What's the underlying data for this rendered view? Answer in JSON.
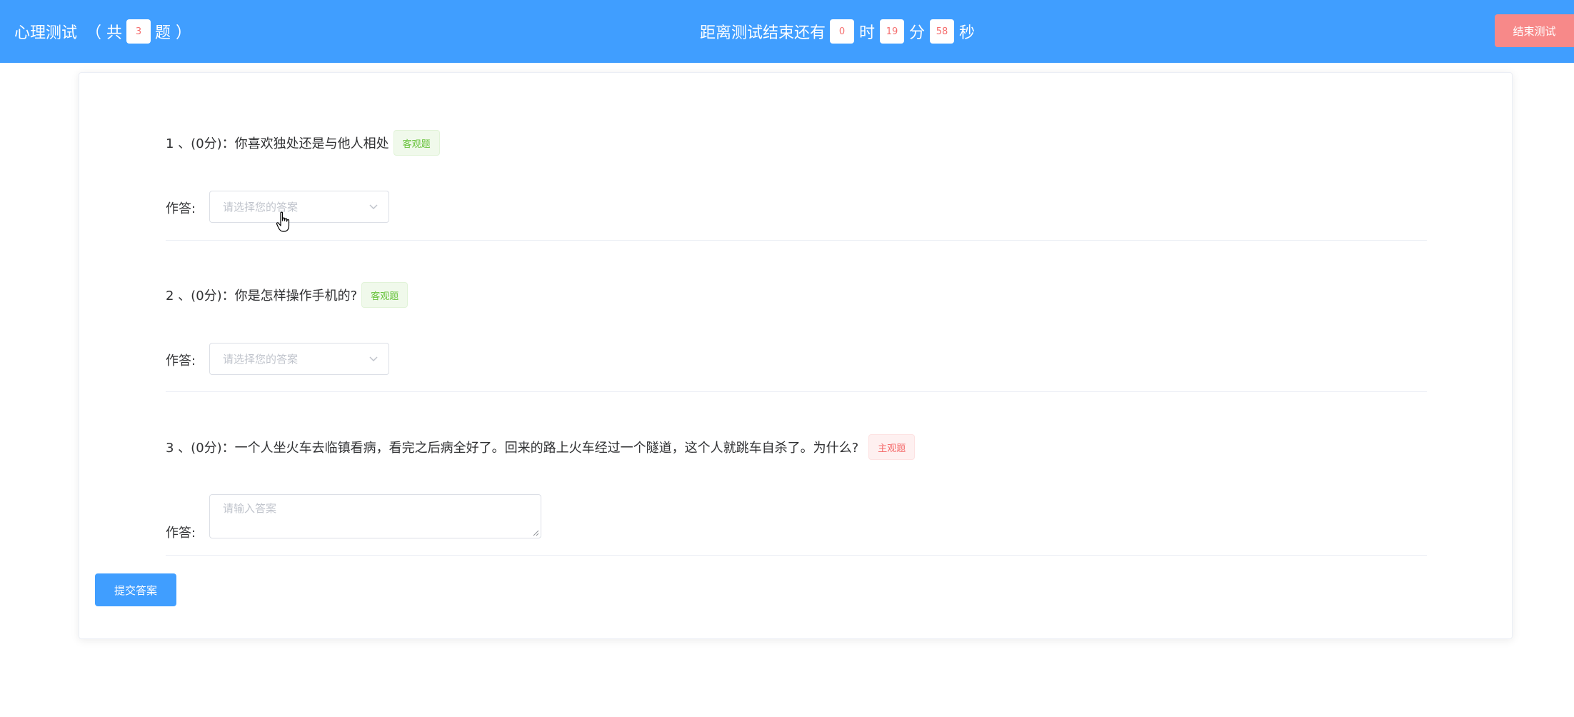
{
  "header": {
    "title": "心理测试",
    "total_prefix": "（ 共",
    "total_count": "3",
    "total_suffix": "题 ）",
    "timer_label": "距离测试结束还有",
    "hours": "0",
    "hours_unit": "时",
    "minutes": "19",
    "minutes_unit": "分",
    "seconds": "58",
    "seconds_unit": "秒",
    "end_button": "结束测试"
  },
  "answer_label": "作答:",
  "questions": [
    {
      "text": "1 、(0分)：你喜欢独处还是与他人相处",
      "tag": "客观题",
      "input_type": "select",
      "placeholder": "请选择您的答案"
    },
    {
      "text": "2 、(0分)：你是怎样操作手机的?",
      "tag": "客观题",
      "input_type": "select",
      "placeholder": "请选择您的答案"
    },
    {
      "text": "3 、(0分)：一个人坐火车去临镇看病，看完之后病全好了。回来的路上火车经过一个隧道，这个人就跳车自杀了。为什么?",
      "tag": "主观题",
      "input_type": "textarea",
      "placeholder": "请输入答案"
    }
  ],
  "submit_button": "提交答案",
  "colors": {
    "primary": "#409eff",
    "danger": "#f56c6c",
    "end_button": "#f78989",
    "objective_tag": "#67c23a",
    "subjective_tag": "#f56c6c"
  },
  "icons": {
    "select_arrow": "chevron-down-icon",
    "cursor": "hand-pointer-icon"
  }
}
